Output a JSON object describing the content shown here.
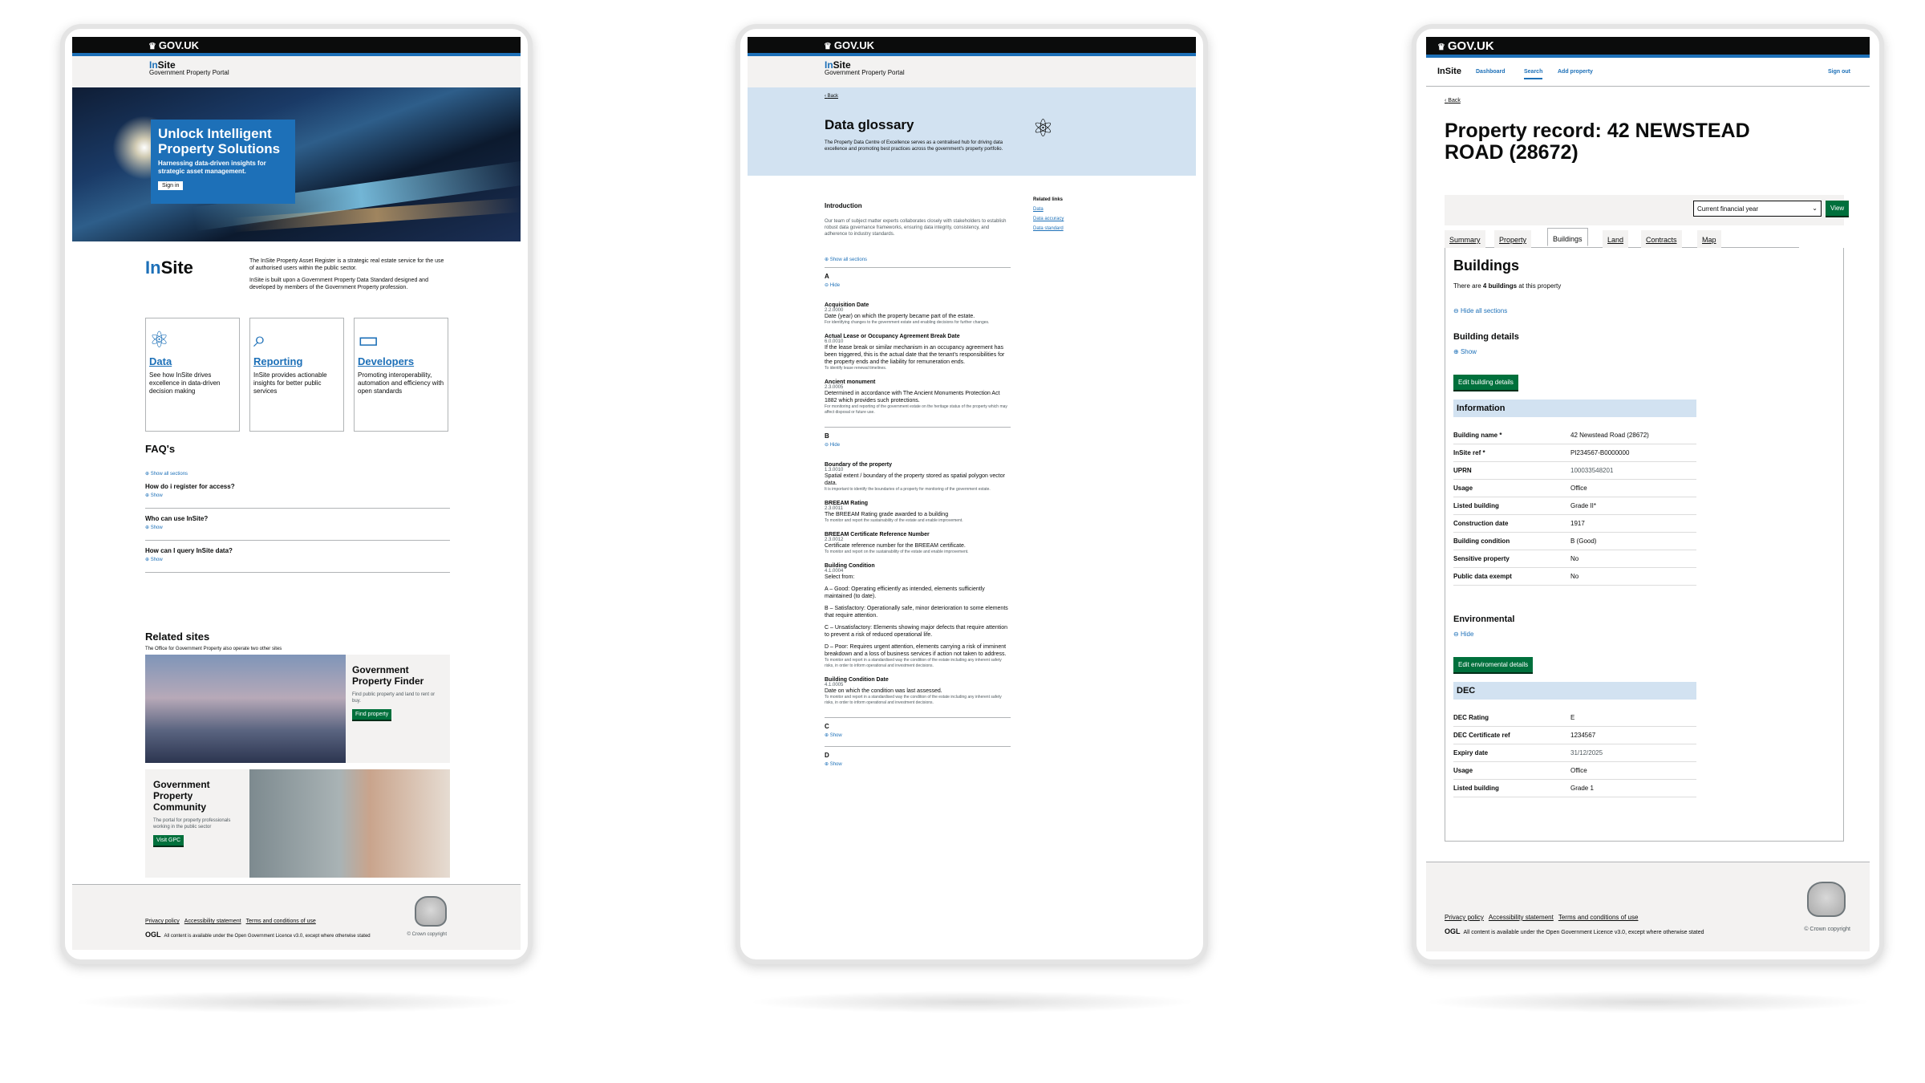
{
  "gov": {
    "brand": "GOV.UK",
    "crown_icon": "crown-icon"
  },
  "service": {
    "name_a": "In",
    "name_b": "Site",
    "portal": "Government Property Portal"
  },
  "s1": {
    "hero": {
      "title": "Unlock Intelligent Property Solutions",
      "subtitle": "Harnessing data-driven insights for strategic asset management.",
      "signin": "Sign in"
    },
    "logo_a": "In",
    "logo_b": "Site",
    "intro1": "The InSite Property Asset Register is a strategic real estate service for the use of authorised users within the public sector.",
    "intro2": "InSite is built upon a Government Property Data Standard designed and developed by members of the Government Property profession.",
    "cards": [
      {
        "title": "Data",
        "text": "See how InSite drives excellence in data-driven decision making"
      },
      {
        "title": "Reporting",
        "text": "InSite provides actionable insights for better public services"
      },
      {
        "title": "Developers",
        "text": "Promoting interoperability, automation and efficiency with open standards"
      }
    ],
    "faq_title": "FAQ's",
    "show_all": "Show all sections",
    "faqs": [
      {
        "q": "How do i register for access?",
        "a": "Show"
      },
      {
        "q": "Who can use InSite?",
        "a": "Show"
      },
      {
        "q": "How can I query InSite data?",
        "a": "Show"
      }
    ],
    "related_title": "Related sites",
    "related_sub": "The Office for Government Property also operate two other sites",
    "gpf": {
      "title": "Government Property Finder",
      "text": "Find public property and land to rent or buy.",
      "button": "Find property"
    },
    "gpc": {
      "title": "Government Property Community",
      "text": "The portal for property professionals working in the public sector",
      "button": "Visit GPC"
    }
  },
  "footer": {
    "links": [
      "Privacy policy",
      "Accessibility statement",
      "Terms and conditions of use"
    ],
    "ogl": "OGL",
    "licence": "All content is available under the Open Government Licence v3.0, except where otherwise stated",
    "copyright": "© Crown copyright"
  },
  "s2": {
    "back": "Back",
    "title": "Data glossary",
    "lede": "The Property Data Centre of Excellence serves as a centralised hub for driving data excellence and promoting best practices across the government's property portfolio.",
    "intro_h": "Introduction",
    "intro": "Our team of subject matter experts collaborates closely with stakeholders to establish robust data governance frameworks, ensuring data integrity, consistency, and adherence to industry standards.",
    "related_h": "Related links",
    "related": [
      "Data",
      "Data accuracy",
      "Data standard"
    ],
    "show_all": "Show all sections",
    "letters": {
      "a": "A",
      "b": "B",
      "c": "C",
      "d": "D"
    },
    "hide": "Hide",
    "show": "Show",
    "terms_a": [
      {
        "name": "Acquisition Date",
        "code": "2.2.0000",
        "def": "Date (year) on which the property became part of the estate.",
        "note": "For identifying changes to the government estate and enabling decisions for further changes."
      },
      {
        "name": "Actual Lease or Occupancy Agreement Break Date",
        "code": "6.0.0010",
        "def": "If the lease break or similar mechanism in an occupancy agreement has been triggered, this is the actual date that the tenant's responsibilities for the property ends and the liability for remuneration ends.",
        "note": "To identify lease renewal timelines."
      },
      {
        "name": "Ancient monument",
        "code": "2.3.0005",
        "def": "Determined in accordance with The Ancient Monuments Protection Act 1882 which provides such protections.",
        "note": "For monitoring and reporting of the government estate on the heritage status of the property which may affect disposal or future use."
      }
    ],
    "terms_b": [
      {
        "name": "Boundary of the property",
        "code": "1.3.0010",
        "def": "Spatial extent / boundary of the property stored as spatial polygon vector data.",
        "note": "It is important to identify the boundaries of a property for monitoring of the government estate."
      },
      {
        "name": "BREEAM Rating",
        "code": "2.3.0011",
        "def": "The BREEAM Rating grade awarded to a building",
        "note": "To monitor and report the sustainability of the estate and enable improvement."
      },
      {
        "name": "BREEAM Certificate Reference Number",
        "code": "2.3.0012",
        "def": "Certificate reference number for the BREEAM certificate.",
        "note": "To monitor and report on the sustainability of the estate and enable improvement."
      }
    ],
    "condition": {
      "name": "Building Condition",
      "code": "4.1.0004",
      "select": "Select from:",
      "opts": [
        "A – Good: Operating efficiently as intended, elements sufficiently maintained (to date).",
        "B – Satisfactory: Operationally safe, minor deterioration to some elements that require attention.",
        "C – Unsatisfactory: Elements showing major defects that require attention to prevent a risk of reduced operational life.",
        "D – Poor: Requires urgent attention, elements carrying a risk of imminent breakdown and a loss of business services if action not taken to address."
      ],
      "note": "To monitor and report in a standardised way the condition of the estate including any inherent safety risks, in order to inform operational and investment decisions."
    },
    "condate": {
      "name": "Building Condition Date",
      "code": "4.1.0005",
      "def": "Date on which the condition was last assessed.",
      "note": "To monitor and report in a standardised way the condition of the estate including any inherent safety risks, in order to inform operational and investment decisions."
    }
  },
  "s3": {
    "nav": {
      "brand": "InSite",
      "items": [
        "Dashboard",
        "Search",
        "Add property"
      ],
      "signout": "Sign out"
    },
    "back": "Back",
    "title": "Property record: 42 NEWSTEAD ROAD (28672)",
    "year_select": "Current financial year",
    "view": "View",
    "tabs": [
      "Summary",
      "Property",
      "Buildings",
      "Land",
      "Contracts",
      "Map"
    ],
    "buildings_h": "Buildings",
    "count_text_a": "There are ",
    "count_text_b": "4 buildings",
    "count_text_c": " at this property",
    "hide_all": "Hide all sections",
    "bd_h": "Building details",
    "show": "Show",
    "edit_building": "Edit building details",
    "info_h": "Information",
    "info": [
      [
        "Building name *",
        "42 Newstead Road (28672)"
      ],
      [
        "InSite ref *",
        "PI234567-B0000000"
      ],
      [
        "UPRN",
        "100033548201"
      ],
      [
        "Usage",
        "Office"
      ],
      [
        "Listed building",
        "Grade II*"
      ],
      [
        "Construction date",
        "1917"
      ],
      [
        "Building condition",
        "B (Good)"
      ],
      [
        "Sensitive property",
        "No"
      ],
      [
        "Public data exempt",
        "No"
      ]
    ],
    "env_h": "Environmental",
    "hide": "Hide",
    "edit_env": "Edit enviromental details",
    "dec_h": "DEC",
    "dec": [
      [
        "DEC Rating",
        "E"
      ],
      [
        "DEC Certificate ref",
        "1234567"
      ],
      [
        "Expiry date",
        "31/12/2025"
      ],
      [
        "Usage",
        "Office"
      ],
      [
        "Listed building",
        "Grade 1"
      ]
    ]
  }
}
